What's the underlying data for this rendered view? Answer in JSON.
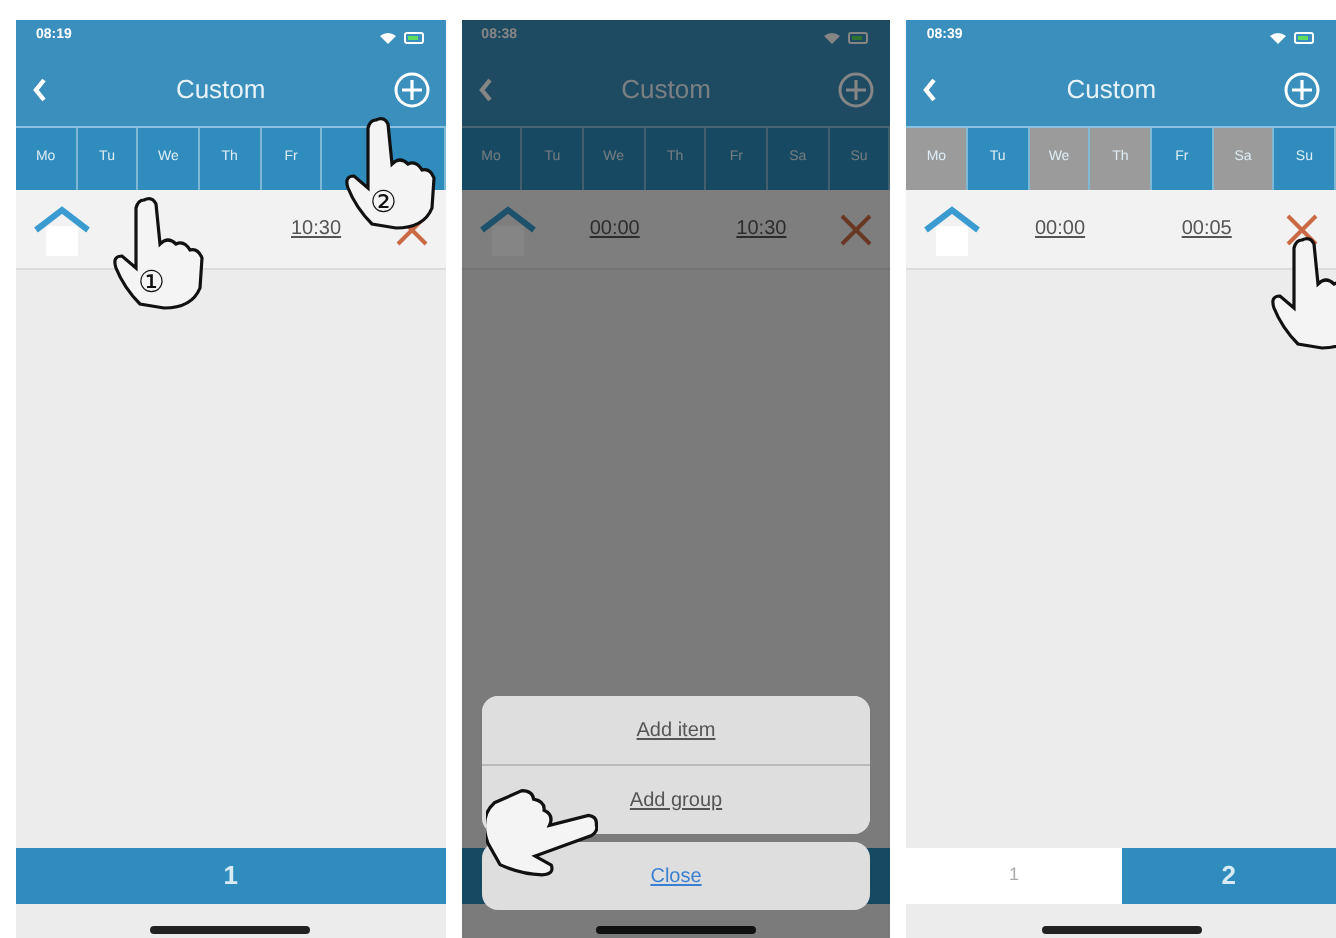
{
  "phones": [
    {
      "status_time": "08:19",
      "title": "Custom",
      "dimmed": false,
      "days": [
        {
          "label": "Mo",
          "selected": true
        },
        {
          "label": "Tu",
          "selected": true
        },
        {
          "label": "We",
          "selected": true
        },
        {
          "label": "Th",
          "selected": true
        },
        {
          "label": "Fr",
          "selected": true
        }
      ],
      "entries": [
        {
          "end": "10:30"
        }
      ],
      "pages": [
        {
          "label": "1",
          "selected": true
        }
      ],
      "hands": [
        {
          "kind": "hand",
          "number": "①"
        },
        {
          "kind": "hand",
          "number": "②"
        }
      ]
    },
    {
      "status_time": "08:38",
      "title": "Custom",
      "dimmed": true,
      "days": [
        {
          "label": "Mo",
          "selected": true
        },
        {
          "label": "Tu",
          "selected": true
        },
        {
          "label": "We",
          "selected": true
        },
        {
          "label": "Th",
          "selected": true
        },
        {
          "label": "Fr",
          "selected": true
        },
        {
          "label": "Sa",
          "selected": true
        },
        {
          "label": "Su",
          "selected": true
        }
      ],
      "entries": [
        {
          "start": "00:00",
          "end": "10:30"
        }
      ],
      "action_sheet": {
        "items": [
          "Add item",
          "Add group"
        ],
        "cancel": "Close"
      },
      "hands": [
        {
          "kind": "hand"
        }
      ]
    },
    {
      "status_time": "08:39",
      "title": "Custom",
      "dimmed": false,
      "days": [
        {
          "label": "Mo",
          "selected": false
        },
        {
          "label": "Tu",
          "selected": true
        },
        {
          "label": "We",
          "selected": false
        },
        {
          "label": "Th",
          "selected": false
        },
        {
          "label": "Fr",
          "selected": true
        },
        {
          "label": "Sa",
          "selected": false
        },
        {
          "label": "Su",
          "selected": true
        }
      ],
      "entries": [
        {
          "start": "00:00",
          "end": "00:05"
        }
      ],
      "pages": [
        {
          "label": "1",
          "selected": false
        },
        {
          "label": "2",
          "selected": true
        }
      ],
      "hands": [
        {
          "kind": "hand"
        }
      ]
    }
  ]
}
